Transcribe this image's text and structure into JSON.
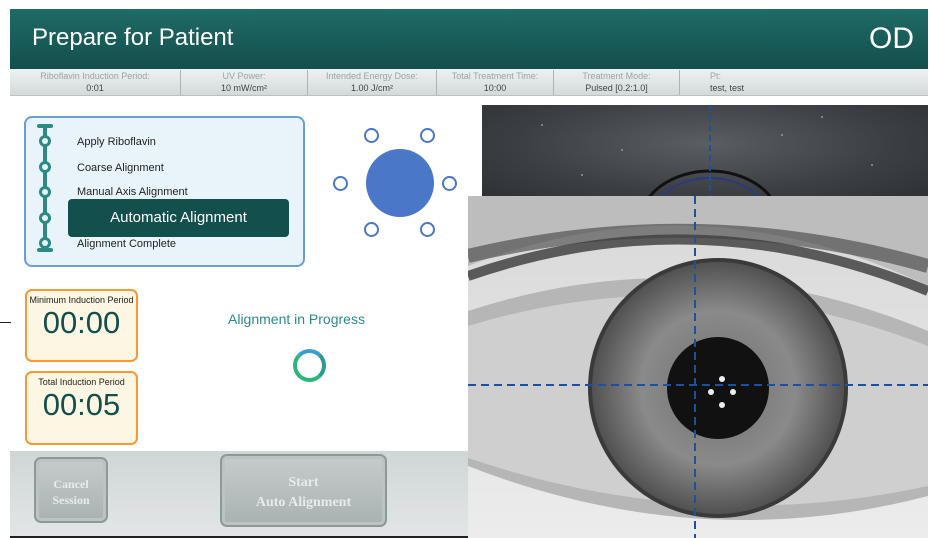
{
  "header": {
    "title": "Prepare for Patient",
    "eye": "OD"
  },
  "info_bar": [
    {
      "label": "Riboflavin Induction Period:",
      "value": "0:01"
    },
    {
      "label": "UV Power:",
      "value": "10 mW/cm²"
    },
    {
      "label": "Intended Energy Dose:",
      "value": "1.00 J/cm²"
    },
    {
      "label": "Total Treatment Time:",
      "value": "10:00"
    },
    {
      "label": "Treatment Mode:",
      "value": "Pulsed [0.2:1.0]"
    },
    {
      "label": "Pt:",
      "value": "test, test"
    }
  ],
  "steps": {
    "items": [
      "Apply Riboflavin",
      "Coarse Alignment",
      "Manual Axis Alignment",
      "Automatic Alignment",
      "Alignment Complete"
    ],
    "active_index": 3
  },
  "timers": {
    "min_induction": {
      "label": "Minimum Induction Period",
      "value": "00:00"
    },
    "total_induction": {
      "label": "Total Induction Period",
      "value": "00:05"
    }
  },
  "status": {
    "text": "Alignment in Progress"
  },
  "buttons": {
    "cancel": {
      "line1": "Cancel",
      "line2": "Session"
    },
    "start": {
      "line1": "Start",
      "line2": "Auto Alignment"
    }
  },
  "colors": {
    "header": "#134f4c",
    "accent": "#2c8a85",
    "timer_border": "#f09a3a",
    "dot": "#4a77c7",
    "crosshair": "#1f4fa0"
  }
}
